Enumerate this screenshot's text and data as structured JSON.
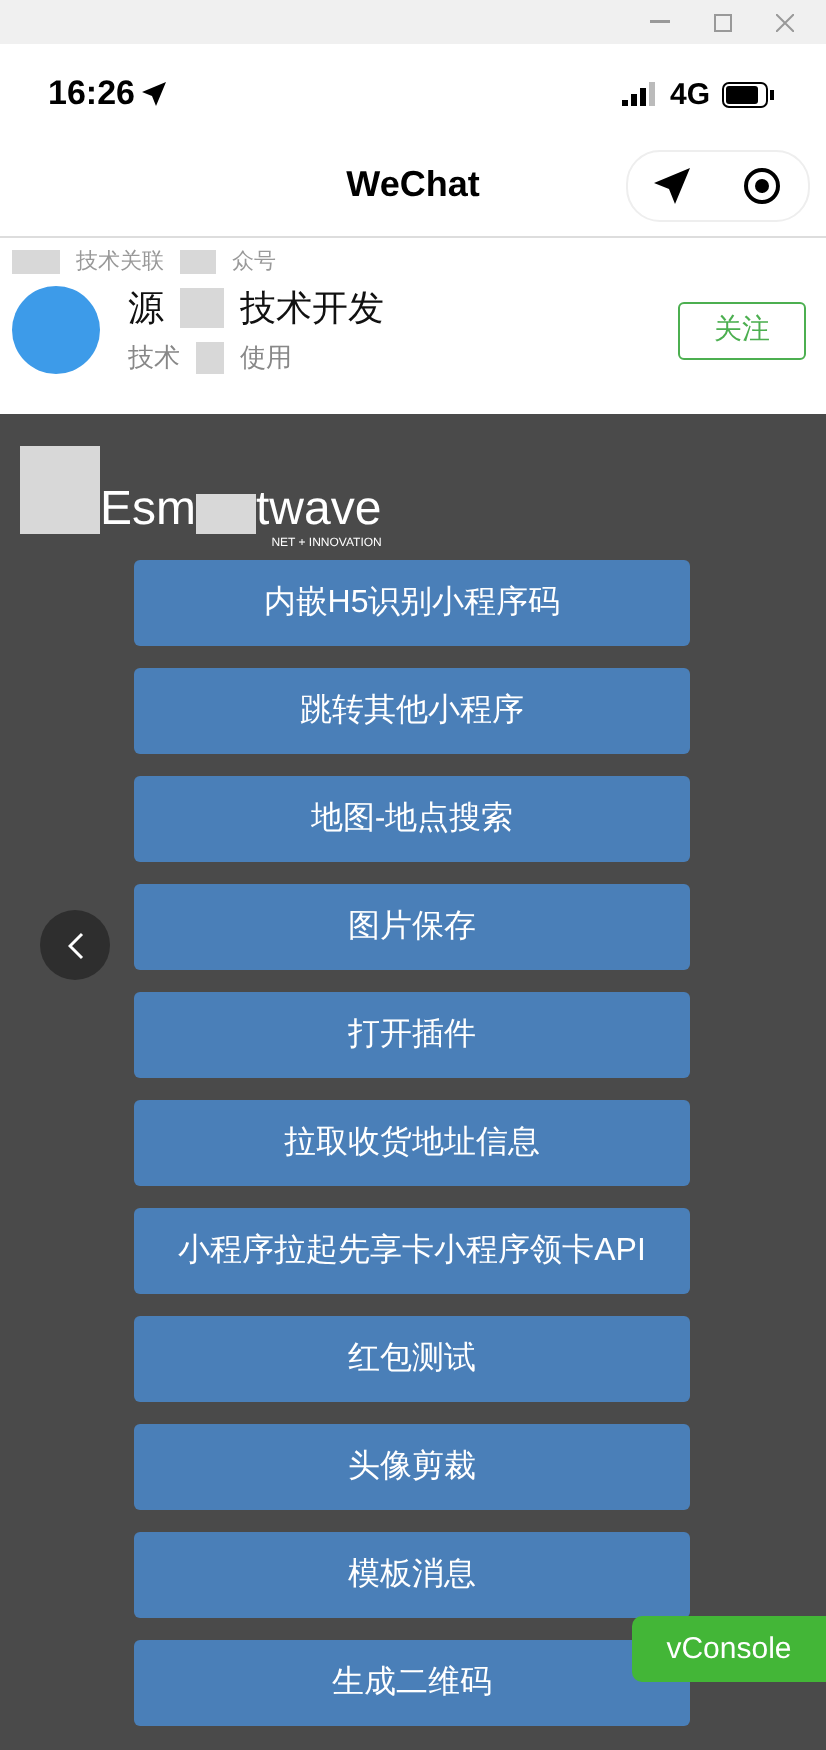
{
  "status_bar": {
    "time": "16:26",
    "network": "4G"
  },
  "nav": {
    "title": "WeChat"
  },
  "account": {
    "label_parts": [
      "技术关联",
      "众号"
    ],
    "name_parts": [
      "源",
      "技术开发"
    ],
    "desc_parts": [
      "技术",
      "使用"
    ],
    "follow": "关注"
  },
  "logo": {
    "parts": [
      "Esm",
      "twave"
    ],
    "tagline": "NET + INNOVATION"
  },
  "buttons": [
    "内嵌H5识别小程序码",
    "跳转其他小程序",
    "地图-地点搜索",
    "图片保存",
    "打开插件",
    "拉取收货地址信息",
    "小程序拉起先享卡小程序领卡API",
    "红包测试",
    "头像剪裁",
    "模板消息",
    "生成二维码"
  ],
  "vconsole": "vConsole"
}
